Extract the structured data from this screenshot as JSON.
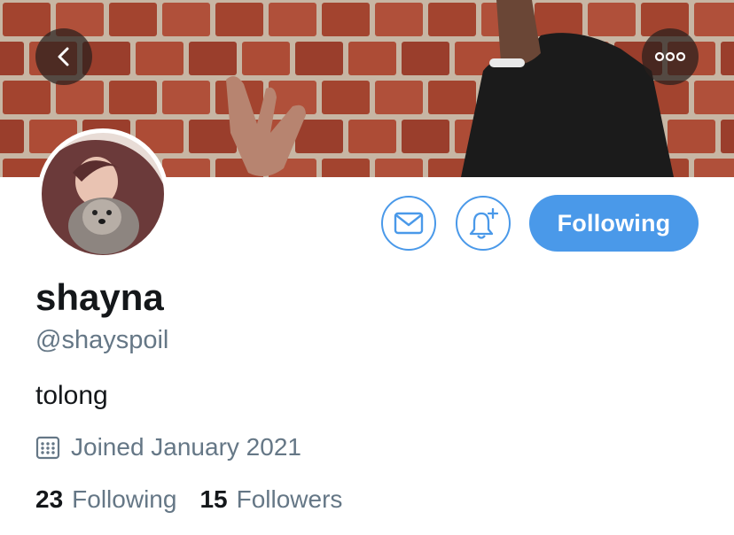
{
  "profile": {
    "display_name": "shayna",
    "handle": "@shayspoil",
    "bio": "tolong",
    "joined": "Joined January 2021"
  },
  "actions": {
    "follow_state_label": "Following"
  },
  "stats": {
    "following_count": "23",
    "following_label": "Following",
    "followers_count": "15",
    "followers_label": "Followers"
  },
  "icons": {
    "back": "chevron-left-icon",
    "more": "ellipsis-icon",
    "message": "envelope-icon",
    "notify": "bell-plus-icon",
    "joined": "calendar-icon"
  },
  "colors": {
    "accent": "#4a99e9",
    "secondary_text": "#657786",
    "primary_text": "#14171a"
  }
}
